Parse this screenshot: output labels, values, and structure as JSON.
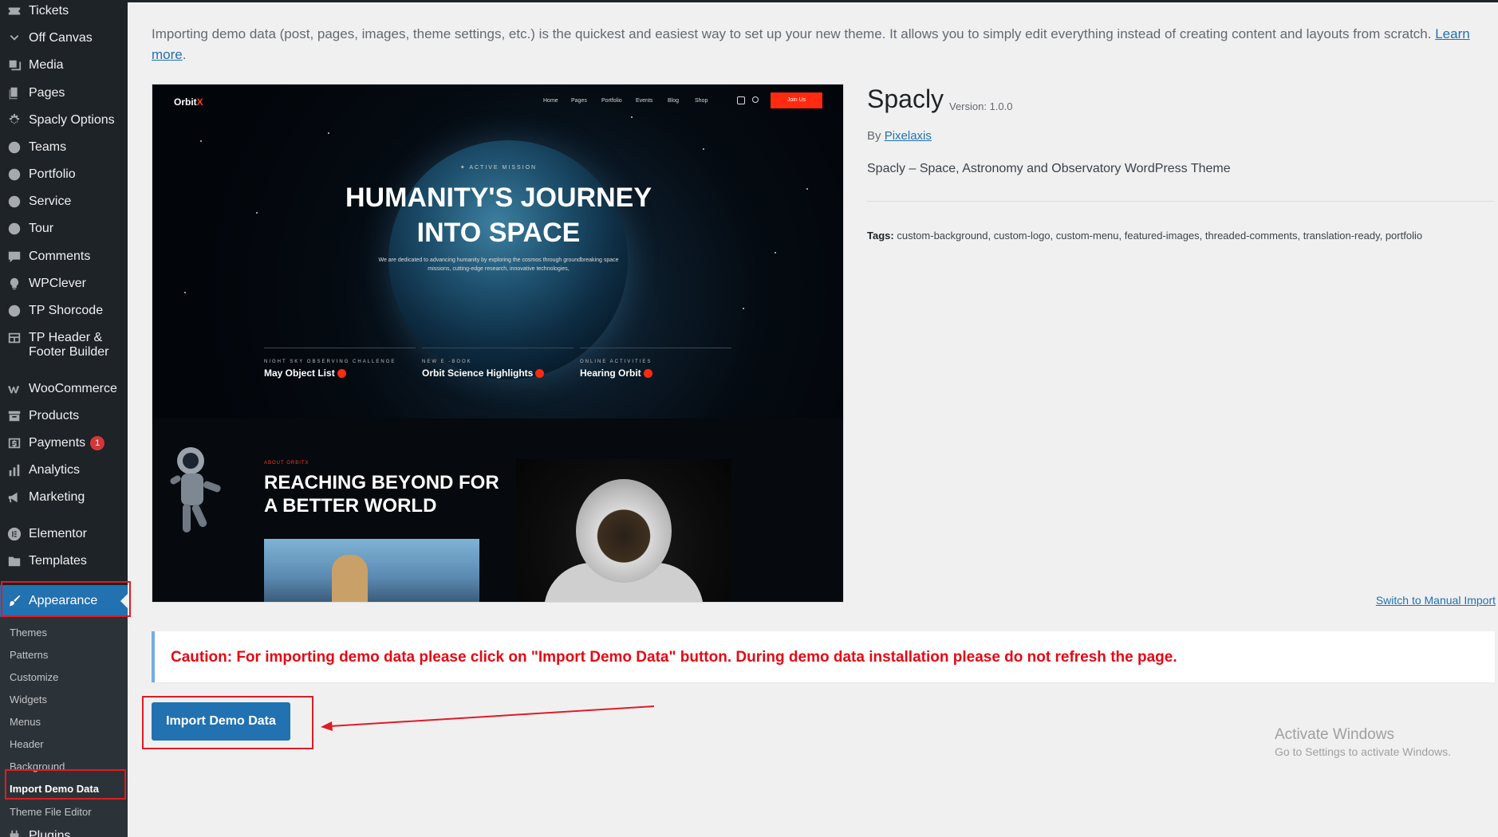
{
  "sidebar": {
    "items": [
      {
        "label": "Tickets",
        "icon": "ticket-icon"
      },
      {
        "label": "Off Canvas",
        "icon": "chevron-down-icon"
      },
      {
        "label": "Media",
        "icon": "media-icon"
      },
      {
        "label": "Pages",
        "icon": "pages-icon"
      },
      {
        "label": "Spacly Options",
        "icon": "gear-icon"
      },
      {
        "label": "Teams",
        "icon": "pin-icon"
      },
      {
        "label": "Portfolio",
        "icon": "pin-icon"
      },
      {
        "label": "Service",
        "icon": "pin-icon"
      },
      {
        "label": "Tour",
        "icon": "pin-icon"
      },
      {
        "label": "Comments",
        "icon": "comment-icon"
      },
      {
        "label": "WPClever",
        "icon": "lightbulb-icon"
      },
      {
        "label": "TP Shorcode",
        "icon": "pin-icon"
      },
      {
        "label": "TP Header & Footer Builder",
        "icon": "grid-icon"
      },
      {
        "label": "WooCommerce",
        "icon": "woocommerce-icon"
      },
      {
        "label": "Products",
        "icon": "archive-icon"
      },
      {
        "label": "Payments",
        "icon": "dollar-icon",
        "badge": "1"
      },
      {
        "label": "Analytics",
        "icon": "bar-chart-icon"
      },
      {
        "label": "Marketing",
        "icon": "megaphone-icon"
      },
      {
        "label": "Elementor",
        "icon": "elementor-icon"
      },
      {
        "label": "Templates",
        "icon": "folder-icon"
      }
    ],
    "appearance": {
      "label": "Appearance",
      "icon": "paintbrush-icon"
    },
    "submenu": [
      {
        "label": "Themes"
      },
      {
        "label": "Patterns"
      },
      {
        "label": "Customize"
      },
      {
        "label": "Widgets"
      },
      {
        "label": "Menus"
      },
      {
        "label": "Header"
      },
      {
        "label": "Background"
      },
      {
        "label": "Import Demo Data",
        "current": true
      },
      {
        "label": "Theme File Editor"
      }
    ],
    "plugins_label": "Plugins"
  },
  "intro": {
    "text": "Importing demo data (post, pages, images, theme settings, etc.) is the quickest and easiest way to set up your new theme. It allows you to simply edit everything instead of creating content and layouts from scratch.",
    "link": "Learn more",
    "link_end": "."
  },
  "preview": {
    "logo_main": "Orbit",
    "logo_accent": "X",
    "nav": [
      "Home",
      "Pages",
      "Portfolio",
      "Events",
      "Blog",
      "Shop"
    ],
    "join": "Join Us",
    "mission": "✦ ACTIVE MISSION",
    "title_line1": "HUMANITY'S JOURNEY",
    "title_line2": "INTO SPACE",
    "subtitle": "We are dedicated to advancing humanity by exploring the cosmos through groundbreaking space missions, cutting-edge research, innovative technologies,",
    "cards": [
      {
        "kicker": "NIGHT SKY OBSERVING CHALLENGE",
        "title": "May Object List"
      },
      {
        "kicker": "NEW  E -BOOK",
        "title": "Orbit Science Highlights"
      },
      {
        "kicker": "ONLINE ACTIVITIES",
        "title": "Hearing Orbit"
      }
    ],
    "about_kicker": "ABOUT ORBITX",
    "heading_line1": "REACHING BEYOND FOR",
    "heading_line2": "A BETTER WORLD"
  },
  "theme": {
    "name": "Spacly",
    "version": "Version: 1.0.0",
    "by": "By",
    "author": "Pixelaxis",
    "description": "Spacly – Space, Astronomy and Observatory WordPress Theme",
    "tags_label": "Tags:",
    "tags": "custom-background, custom-logo, custom-menu, featured-images, threaded-comments, translation-ready, portfolio",
    "switch_manual": "Switch to Manual Import"
  },
  "caution": {
    "text": "Caution: For importing demo data please click on \"Import Demo Data\" button. During demo data installation please do not refresh the page."
  },
  "import_button": {
    "label": "Import Demo Data"
  },
  "watermark": {
    "title": "Activate Windows",
    "subtitle": "Go to Settings to activate Windows."
  },
  "colors": {
    "sidebar_bg": "#1d2327",
    "accent": "#2271b1",
    "highlight_box": "#e01b24",
    "caution_text": "#e50914",
    "preview_accent": "#ff2a10"
  }
}
